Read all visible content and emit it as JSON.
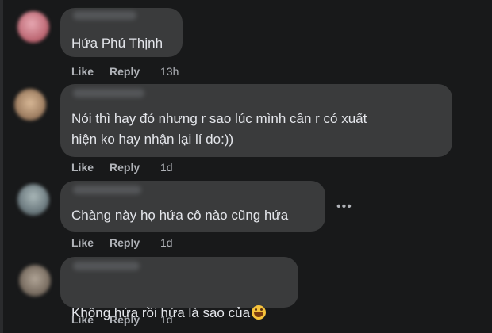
{
  "comments": [
    {
      "text": "Hứa Phú Thịnh",
      "like": "Like",
      "reply": "Reply",
      "time": "13h",
      "avatar_color": "#d48a96"
    },
    {
      "text": "Nói thì hay đó nhưng r sao lúc mình cần r có xuất\nhiện ko hay nhận lại lí do:))",
      "like": "Like",
      "reply": "Reply",
      "time": "1d",
      "avatar_color": "#b89a7a"
    },
    {
      "text": "Chàng này họ hứa cô nào cũng hứa",
      "like": "Like",
      "reply": "Reply",
      "time": "1d",
      "avatar_color": "#7d8c90",
      "more": "•••"
    },
    {
      "text": "Không hứa rồi hứa là sao của",
      "emoji": "grinning-sweat-emoji",
      "like": "Like",
      "reply": "Reply",
      "time": "1d",
      "avatar_color": "#8a7e72"
    }
  ]
}
